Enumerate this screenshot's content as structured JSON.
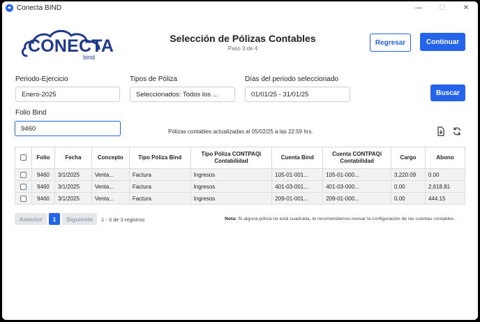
{
  "window": {
    "title": "Conecta BIND"
  },
  "logo": {
    "word": "CONECTA",
    "sub": "bind"
  },
  "header": {
    "title": "Selección de Pólizas Contables",
    "step": "Paso 3 de 4"
  },
  "buttons": {
    "back": "Regresar",
    "continue": "Continuar",
    "search": "Buscar"
  },
  "filters": {
    "period_label": "Periodo-Ejercicio",
    "period_value": "Enero-2025",
    "types_label": "Tipos de Póliza",
    "types_value": "Seleccionados: Todos los ...",
    "days_label": "Días del periodo seleccionado",
    "days_value": "01/01/25 - 31/01/25",
    "folio_label": "Folio Bind",
    "folio_value": "9460"
  },
  "info": "Pólizas contables actualizadas al 05/02/25 a las 22:59 hrs.",
  "icons": {
    "export": "file-download-icon",
    "refresh": "refresh-icon"
  },
  "table": {
    "headers": [
      "Folio",
      "Fecha",
      "Concepto",
      "Tipo Póliza Bind",
      "Tipo Póliza CONTPAQi Contabilidad",
      "Cuenta Bind",
      "Cuenta CONTPAQi Contabilidad",
      "Cargo",
      "Abono"
    ],
    "rows": [
      [
        "9460",
        "3/1/2025",
        "Venta...",
        "Factura",
        "Ingresos",
        "105-01-001...",
        "105-01-000...",
        "3,220.09",
        "0.00"
      ],
      [
        "9460",
        "3/1/2025",
        "Venta...",
        "Factura",
        "Ingresos",
        "401-03-001...",
        "401-03-000...",
        "0.00",
        "2,618.81"
      ],
      [
        "9460",
        "3/1/2025",
        "Venta...",
        "Factura",
        "Ingresos",
        "209-01-001...",
        "209-01-000...",
        "0.00",
        "444.15"
      ]
    ]
  },
  "pager": {
    "prev": "Anterior",
    "page": "1",
    "next": "Siguiente",
    "info": "1 - 3 de 3 registros"
  },
  "note": {
    "label": "Nota:",
    "text": " Si alguna póliza no está cuadrada, te recomendamos revisar la configuración de las cuentas contables."
  },
  "colors": {
    "accent": "#2563eb",
    "brand": "#1f3a8a"
  }
}
